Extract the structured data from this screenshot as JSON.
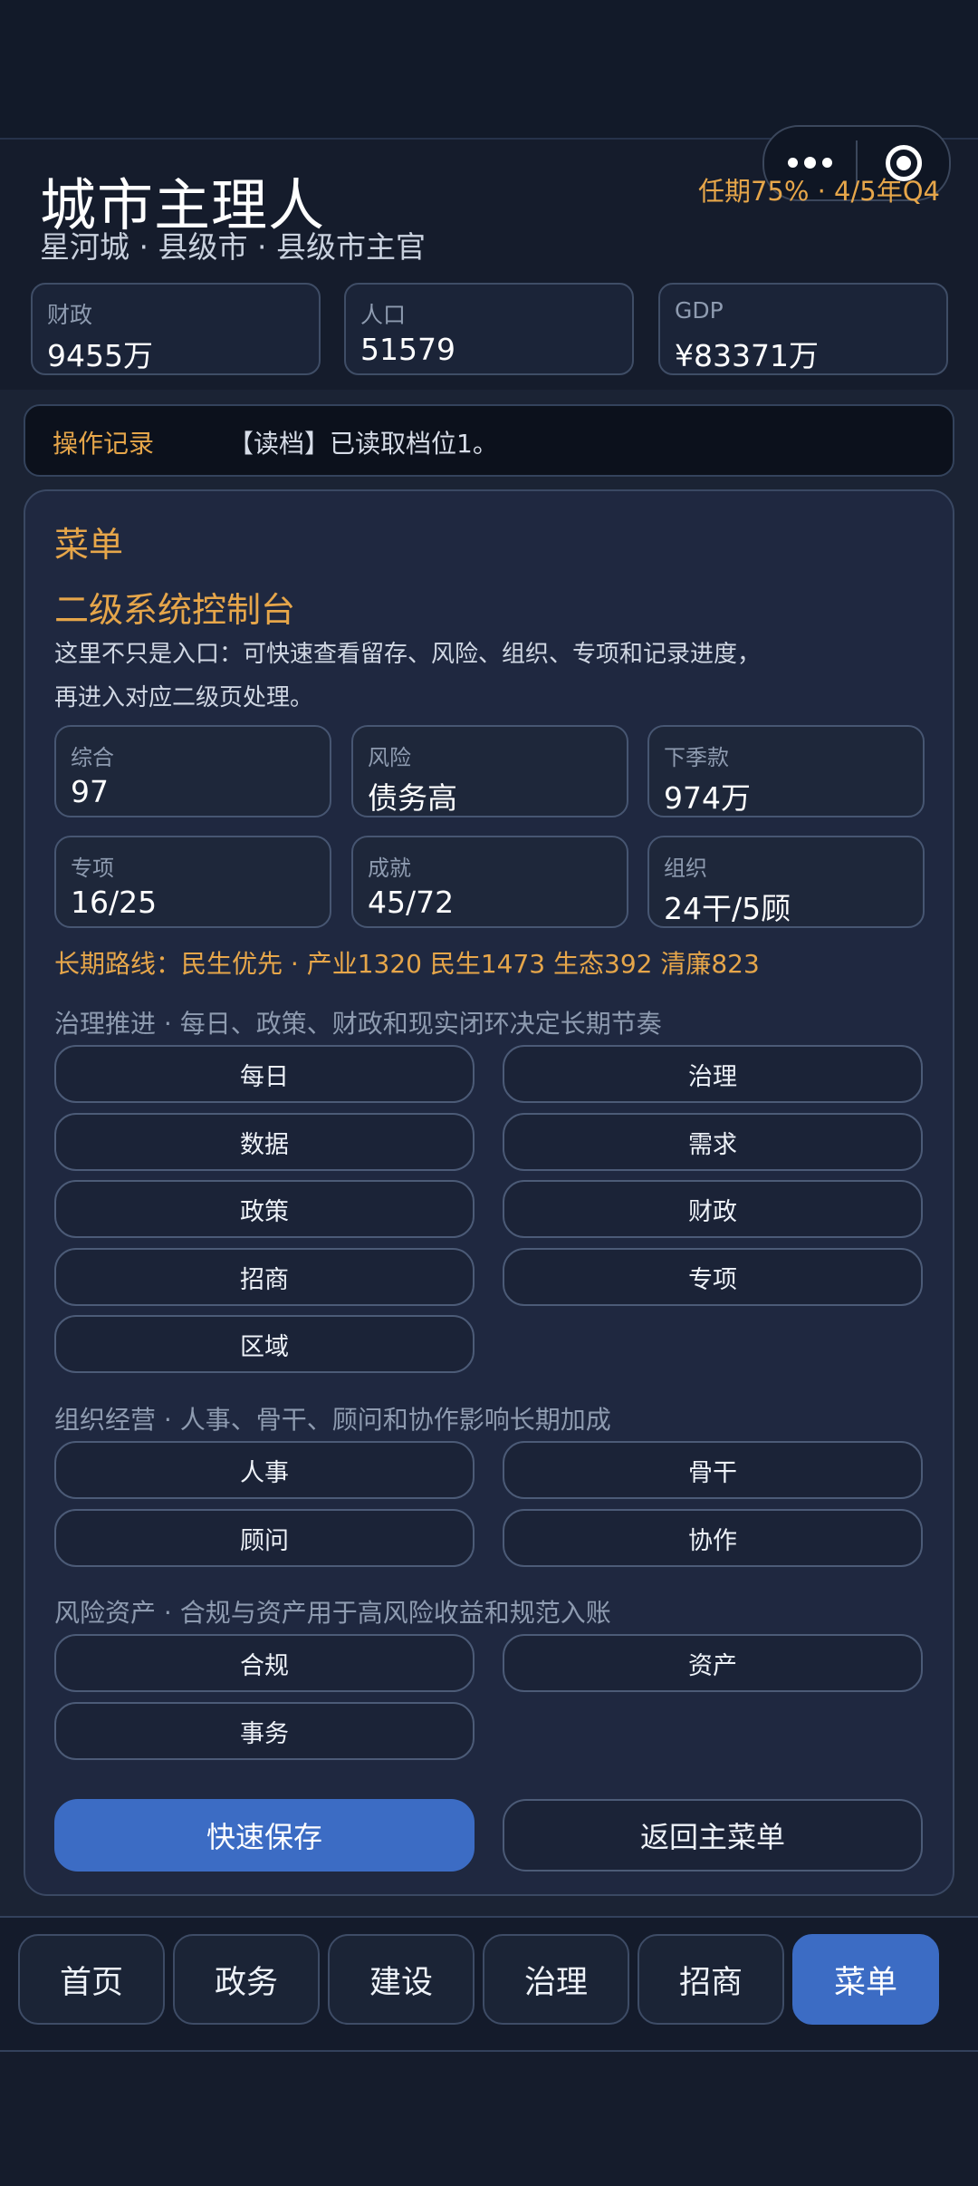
{
  "header": {
    "title": "城市主理人",
    "subtitle": "星河城 · 县级市 · 县级市主官",
    "term": "任期75% · 4/5年Q4"
  },
  "stats": [
    {
      "label": "财政",
      "value": "9455万"
    },
    {
      "label": "人口",
      "value": "51579"
    },
    {
      "label": "GDP",
      "value": "¥83371万"
    }
  ],
  "oplog": {
    "label": "操作记录",
    "text": "【读档】已读取档位1。"
  },
  "panel": {
    "title": "菜单",
    "console_title": "二级系统控制台",
    "description": "这里不只是入口：可快速查看留存、风险、组织、专项和记录进度，再进入对应二级页处理。",
    "cards": [
      {
        "label": "综合",
        "value": "97"
      },
      {
        "label": "风险",
        "value": "债务高"
      },
      {
        "label": "下季款",
        "value": "974万"
      },
      {
        "label": "专项",
        "value": "16/25"
      },
      {
        "label": "成就",
        "value": "45/72"
      },
      {
        "label": "组织",
        "value": "24干/5顾"
      }
    ],
    "route": "长期路线：民生优先 · 产业1320 民生1473 生态392 清廉823",
    "sections": [
      {
        "title": "治理推进 · 每日、政策、财政和现实闭环决定长期节奏",
        "buttons": [
          "每日",
          "治理",
          "数据",
          "需求",
          "政策",
          "财政",
          "招商",
          "专项",
          "区域"
        ]
      },
      {
        "title": "组织经营 · 人事、骨干、顾问和协作影响长期加成",
        "buttons": [
          "人事",
          "骨干",
          "顾问",
          "协作"
        ]
      },
      {
        "title": "风险资产 · 合规与资产用于高风险收益和规范入账",
        "buttons": [
          "合规",
          "资产",
          "事务"
        ]
      }
    ],
    "quick_save": "快速保存",
    "back_main": "返回主菜单"
  },
  "nav": [
    "首页",
    "政务",
    "建设",
    "治理",
    "招商",
    "菜单"
  ],
  "colors": {
    "accent": "#e6a64a",
    "primary": "#3c6cc4",
    "background": "#151c2c"
  },
  "icons": {
    "more": "more-dots-icon",
    "close": "target-circle-icon"
  }
}
